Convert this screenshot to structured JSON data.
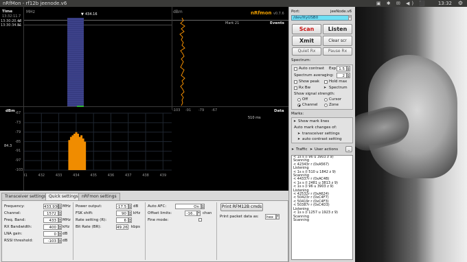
{
  "titlebar": {
    "title": "nRfMon - rf12b jeenode.v6",
    "time": "13:32",
    "tray_icons": "▣ ✱ ✉ ◀) ⬛"
  },
  "plot": {
    "brand_name": "nRfmon",
    "brand_version": "v0.7.6",
    "time_label": "Time",
    "time_sub": "13:32:11.7",
    "mhz_label": "MHz",
    "dbm_label": "dBm",
    "marker_freq": "434.16",
    "time_stamps": [
      "13:30:20.48",
      "13:30:34.81"
    ],
    "mark_label": "Mark 21",
    "events_label": "Events",
    "dbm_axis_label": "dBm",
    "data_label": "Data",
    "data_ms": "510 ms",
    "rssi_value": "84.3",
    "dbm_ticks": [
      "-67",
      "-73",
      "-79",
      "-85",
      "-91",
      "-97",
      "-103"
    ],
    "freq_ticks": [
      "431",
      "432",
      "433",
      "434",
      "435",
      "436",
      "437",
      "438",
      "439"
    ],
    "time_dbm_ticks": [
      "-103",
      "-91",
      "-79",
      "-67"
    ]
  },
  "tabs": [
    {
      "label": "Transceiver settings"
    },
    {
      "label": "Quick settings"
    },
    {
      "label": "nRFmon settings"
    }
  ],
  "transceiver": {
    "frequency": {
      "label": "Frequency:",
      "value": "433.9300",
      "unit": "MHz"
    },
    "channel": {
      "label": "Channel:",
      "value": "1572"
    },
    "freq_band": {
      "label": "Freq. Band:",
      "value": "433",
      "unit": "MHz"
    },
    "rx_bandwidth": {
      "label": "RX Bandwidth:",
      "value": "400",
      "unit": "kHz"
    },
    "lna_gain": {
      "label": "LNA gain:",
      "value": "0",
      "unit": "dB"
    },
    "rssi_threshold": {
      "label": "RSSI threshold:",
      "value": "-103",
      "unit": "dB"
    },
    "power_output": {
      "label": "Power output:",
      "value": "-17.5",
      "unit": "dB"
    },
    "fsk_shift": {
      "label": "FSK shift:",
      "value": "90",
      "unit": "kHz"
    },
    "rate_setting": {
      "label": "Rate setting (R):",
      "value": "6"
    },
    "bit_rate": {
      "label": "Bit Rate (BR):",
      "value": "49.26",
      "unit": "kbps"
    },
    "auto_afc": {
      "label": "Auto AFC:",
      "value": "On"
    },
    "offset_limits": {
      "label": "Offset limits:",
      "value": "-16..",
      "unit": "chan"
    },
    "fine_mode": {
      "label": "Fine mode:"
    },
    "print_button": "Print RFM12B cmds",
    "print_packet_label": "Print packet data as:",
    "print_packet_value": "hex"
  },
  "right": {
    "port_label": "Port:",
    "port_name": "jeeNode.v6",
    "port_value": "/dev/ttyUSB0",
    "scan": "Scan",
    "listen": "Listen",
    "xmit": "Xmit",
    "clear": "Clear scr",
    "quiet": "Quiet Rx",
    "pause": "Pause Rx",
    "spectrum_label": "Spectrum:",
    "auto_contrast": "Auto contrast",
    "exp_label": "Exp:",
    "exp_value": "1.5",
    "averaging": "Spectrum averaging:",
    "avg_value": "2",
    "show_peak": "Show peak",
    "hold_max": "Hold max",
    "rx_bw": "Rx Bw",
    "spectrum": "Spectrum",
    "signal_label": "Show signal strength:",
    "off": "Off",
    "cursor": "Cursor",
    "channel": "Channel",
    "zone": "Zone",
    "marks_label": "Marks:",
    "show_marks": "Show mark lines",
    "auto_mark": "Auto mark changes of:",
    "transceiver_settings": "transceiver settings",
    "auto_contrast_setting": "auto contrast setting",
    "traffic": "Traffic",
    "user_actions": "User actions",
    "log": [
      "< 1s  s (l 96 u 3903 z 9)",
      "  Scanning",
      "< 42343r  r (0xA567)",
      "  Listening",
      "< 1s  s (l 510 u 1842 z 9)",
      "  Scanning",
      "< 44337r  r (0xAC4B)",
      "< 1s  s (l 2481 u 3813 z 9)",
      "< 1s  s (l 96 u 3903 z 9)",
      "  Listening",
      "< 42532r  r (0xA624)",
      "< 50423r  r (0xC4F7)",
      "< 50419r  r (0xC4F3)",
      "< 50387r  r (0xC4D3)",
      "  Listening",
      "< 1s  s (l 1257 u 1923 z 9)",
      "  Scanning",
      "  Scanning"
    ]
  },
  "chart_data": {
    "type": "bar",
    "title": "",
    "xlabel": "",
    "ylabel": "dBm",
    "categories": [
      "433.6",
      "433.7",
      "433.8",
      "433.9",
      "434.0",
      "434.1",
      "434.2",
      "434.3",
      "434.4",
      "434.5"
    ],
    "values": [
      -84,
      -82,
      -81,
      -80,
      -79,
      -80,
      -82,
      -81,
      -83,
      -85
    ],
    "ylim": [
      -103,
      -67
    ],
    "xlim": [
      431,
      439.5
    ]
  },
  "colors": {
    "accent": "#f08c00",
    "waterfall": "#3a3f8a",
    "scan_text": "#c8100f",
    "port_field": "#6ee0f5"
  }
}
